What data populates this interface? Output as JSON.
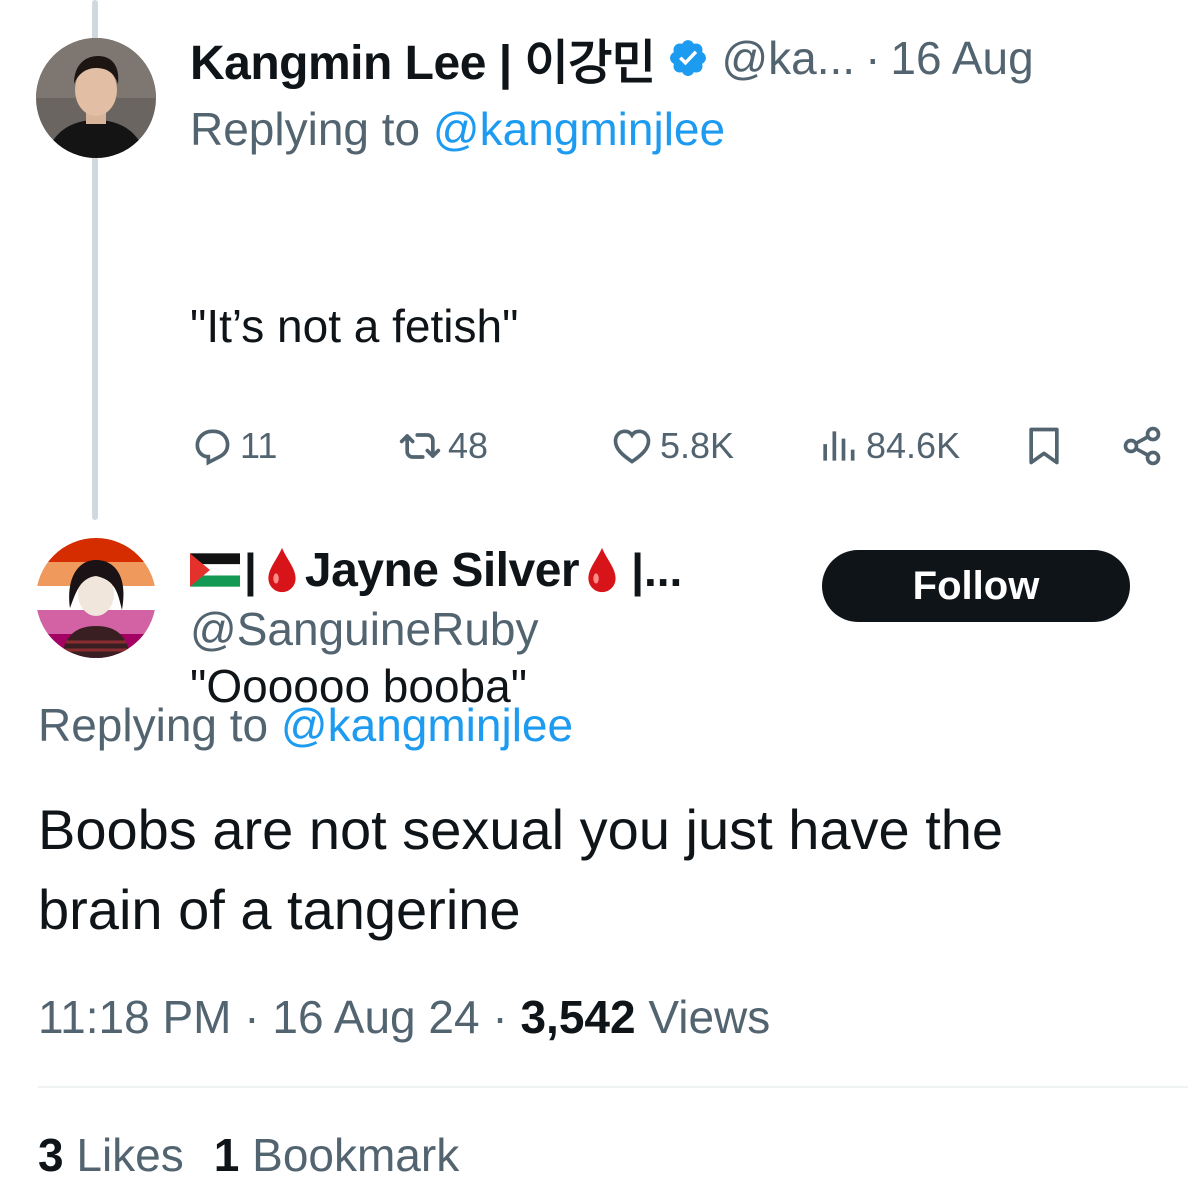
{
  "tweet1": {
    "display_name": "Kangmin Lee | 이강민",
    "handle_truncated": "@ka...",
    "separator": "·",
    "time": "16 Aug",
    "replying_prefix": "Replying to ",
    "replying_to": "@kangminjlee",
    "text_line1": "\"It’s not a fetish\"",
    "text_line2": "\"Oooooo booba\"",
    "actions": {
      "replies": "11",
      "retweets": "48",
      "likes": "5.8K",
      "views": "84.6K"
    },
    "icons": [
      "reply-icon",
      "retweet-icon",
      "like-icon",
      "views-icon",
      "bookmark-icon",
      "share-icon"
    ]
  },
  "tweet2": {
    "display_name": "Jayne Silver",
    "trunc": "|...",
    "pipe": "|",
    "handle": "@SanguineRuby",
    "follow_label": "Follow",
    "replying_prefix": "Replying to ",
    "replying_to": "@kangminjlee",
    "text_line1": "Boobs are not sexual you just have the",
    "text_line2": "brain of a tangerine",
    "timestamp": "11:18 PM",
    "separator": "·",
    "date": "16 Aug 24",
    "views_count": "3,542",
    "views_label": "Views",
    "likes_count": "3",
    "likes_label": "Likes",
    "bookmarks_count": "1",
    "bookmarks_label": "Bookmark"
  },
  "colors": {
    "text": "#0f1419",
    "secondary": "#536471",
    "link": "#1d9bf0",
    "verified": "#1d9bf0",
    "follow_bg": "#0f1419",
    "thread_line": "#cfd9de"
  }
}
